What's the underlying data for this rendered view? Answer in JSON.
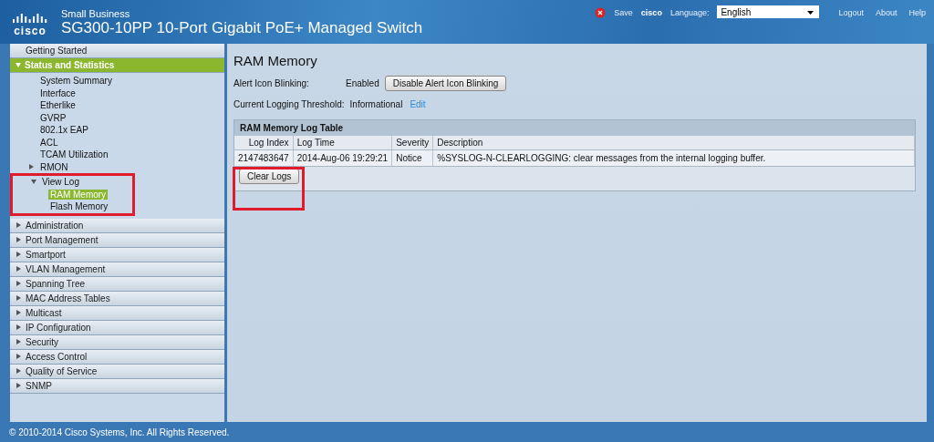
{
  "header": {
    "subtitle": "Small Business",
    "title": "SG300-10PP 10-Port Gigabit PoE+ Managed Switch",
    "logo_word": "cisco",
    "save": "Save",
    "user": "cisco",
    "language_label": "Language:",
    "language": "English",
    "links": [
      "Logout",
      "About",
      "Help"
    ]
  },
  "sidebar": {
    "items": [
      {
        "label": "Getting Started",
        "selected": false
      },
      {
        "label": "Status and Statistics",
        "expanded": true,
        "selected": true,
        "children": [
          {
            "label": "System Summary",
            "selected": false
          },
          {
            "label": "Interface",
            "selected": false
          },
          {
            "label": "Etherlike",
            "selected": false
          },
          {
            "label": "GVRP",
            "selected": false
          },
          {
            "label": "802.1x EAP",
            "selected": false
          },
          {
            "label": "ACL",
            "selected": false
          },
          {
            "label": "TCAM Utilization",
            "selected": false
          },
          {
            "label": "RMON",
            "expanded": false,
            "selected": false
          },
          {
            "label": "View Log",
            "expanded": true,
            "selected": false,
            "highlighted": true,
            "children": [
              {
                "label": "RAM Memory",
                "selected": true
              },
              {
                "label": "Flash Memory",
                "selected": false
              }
            ]
          }
        ]
      },
      {
        "label": "Administration",
        "expanded": false,
        "selected": false
      },
      {
        "label": "Port Management",
        "expanded": false,
        "selected": false
      },
      {
        "label": "Smartport",
        "expanded": false,
        "selected": false
      },
      {
        "label": "VLAN Management",
        "expanded": false,
        "selected": false
      },
      {
        "label": "Spanning Tree",
        "expanded": false,
        "selected": false
      },
      {
        "label": "MAC Address Tables",
        "expanded": false,
        "selected": false
      },
      {
        "label": "Multicast",
        "expanded": false,
        "selected": false
      },
      {
        "label": "IP Configuration",
        "expanded": false,
        "selected": false
      },
      {
        "label": "Security",
        "expanded": false,
        "selected": false
      },
      {
        "label": "Access Control",
        "expanded": false,
        "selected": false
      },
      {
        "label": "Quality of Service",
        "expanded": false,
        "selected": false
      },
      {
        "label": "SNMP",
        "expanded": false,
        "selected": false
      }
    ]
  },
  "content": {
    "title": "RAM Memory",
    "alert": {
      "label": "Alert Icon Blinking:",
      "value": "Enabled",
      "button": "Disable Alert Icon Blinking"
    },
    "threshold": {
      "label": "Current Logging Threshold:",
      "value": "Informational",
      "link": "Edit"
    },
    "table": {
      "title": "RAM Memory Log Table",
      "columns": [
        "Log Index",
        "Log Time",
        "Severity",
        "Description"
      ],
      "rows": [
        [
          "2147483647",
          "2014-Aug-06 19:29:21",
          "Notice",
          "%SYSLOG-N-CLEARLOGGING: clear messages from the internal logging buffer."
        ]
      ],
      "button": "Clear Logs",
      "button_highlighted": true
    }
  },
  "footer": "© 2010-2014 Cisco Systems, Inc. All Rights Reserved."
}
